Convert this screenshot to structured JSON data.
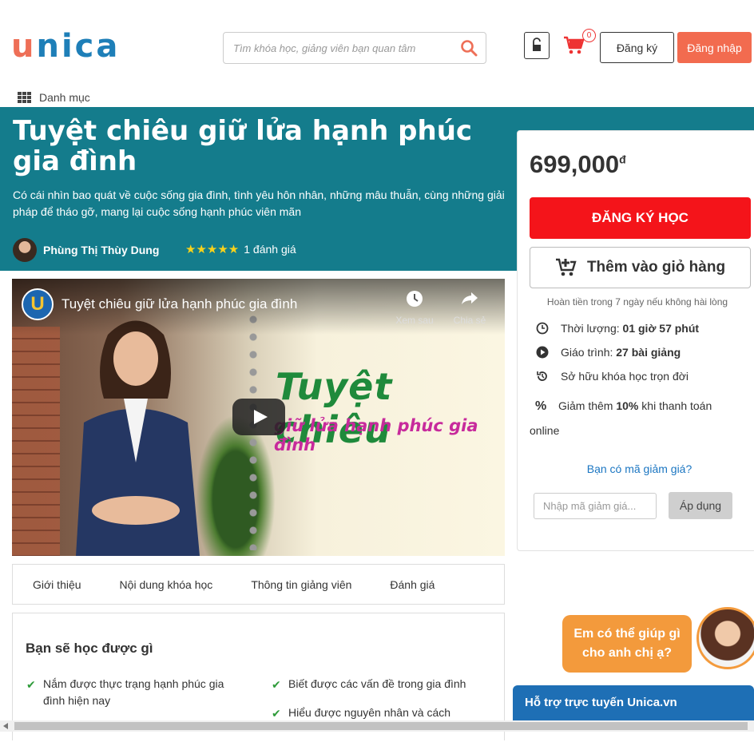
{
  "header": {
    "logo_u": "u",
    "logo_rest": "nica",
    "search_placeholder": "Tìm khóa học, giảng viên bạn quan tâm",
    "cart_count": "0",
    "register_label": "Đăng ký",
    "login_label": "Đăng nhập",
    "category_label": "Danh mục"
  },
  "course": {
    "title": "Tuyệt chiêu giữ lửa hạnh phúc gia đình",
    "description": "Có cái nhìn bao quát về cuộc sống gia đình, tình yêu hôn nhân, những mâu thuẫn, cùng những giải pháp để tháo gỡ, mang lại cuộc sống hạnh phúc viên mãn",
    "instructor": "Phùng Thị Thùy Dung",
    "stars": "★★★★★",
    "rating_count": "1 đánh giá"
  },
  "video": {
    "channel_letter": "U",
    "title": "Tuyệt chiêu giữ lửa hạnh phúc gia đình",
    "watch_later": "Xem sau",
    "share": "Chia sẻ",
    "overlay_line1": "Tuyệt chiêu",
    "overlay_line2": "giữ lửa hạnh phúc gia đình"
  },
  "tabs": [
    "Giới thiệu",
    "Nội dung khóa học",
    "Thông tin giảng viên",
    "Đánh giá"
  ],
  "learn": {
    "title": "Bạn sẽ học được gì",
    "items": [
      "Nắm được thực trạng hạnh phúc gia đình hiện nay",
      "Biết được các vấn đề trong gia đình",
      "Hiểu được nguyên nhân và cách"
    ]
  },
  "sidebar": {
    "price": "699,000",
    "currency": "đ",
    "enroll_label": "ĐĂNG KÝ HỌC",
    "add_cart_label": "Thêm vào giỏ hàng",
    "refund_note": "Hoàn tiền trong 7 ngày nếu không hài lòng",
    "duration_label": "Thời lượng:",
    "duration_value": "01 giờ 57 phút",
    "curriculum_label": "Giáo trình:",
    "curriculum_value": "27 bài giảng",
    "lifetime": "Sở hữu khóa học trọn đời",
    "discount_prefix": "Giảm thêm",
    "discount_value": "10%",
    "discount_suffix": "khi thanh toán online",
    "coupon_question": "Bạn có mã giảm giá?",
    "coupon_placeholder": "Nhập mã giảm giá...",
    "apply_label": "Áp dụng"
  },
  "chat": {
    "bubble": "Em có thể giúp gì cho anh chị ạ?",
    "support": "Hỗ trợ trực tuyến Unica.vn"
  },
  "colors": {
    "brand_orange": "#ee6f57",
    "brand_blue": "#1e7fb8",
    "banner": "#147c8c",
    "enroll_red": "#f4141a",
    "chat_orange": "#f39a3c",
    "support_blue": "#1e6fb5"
  }
}
